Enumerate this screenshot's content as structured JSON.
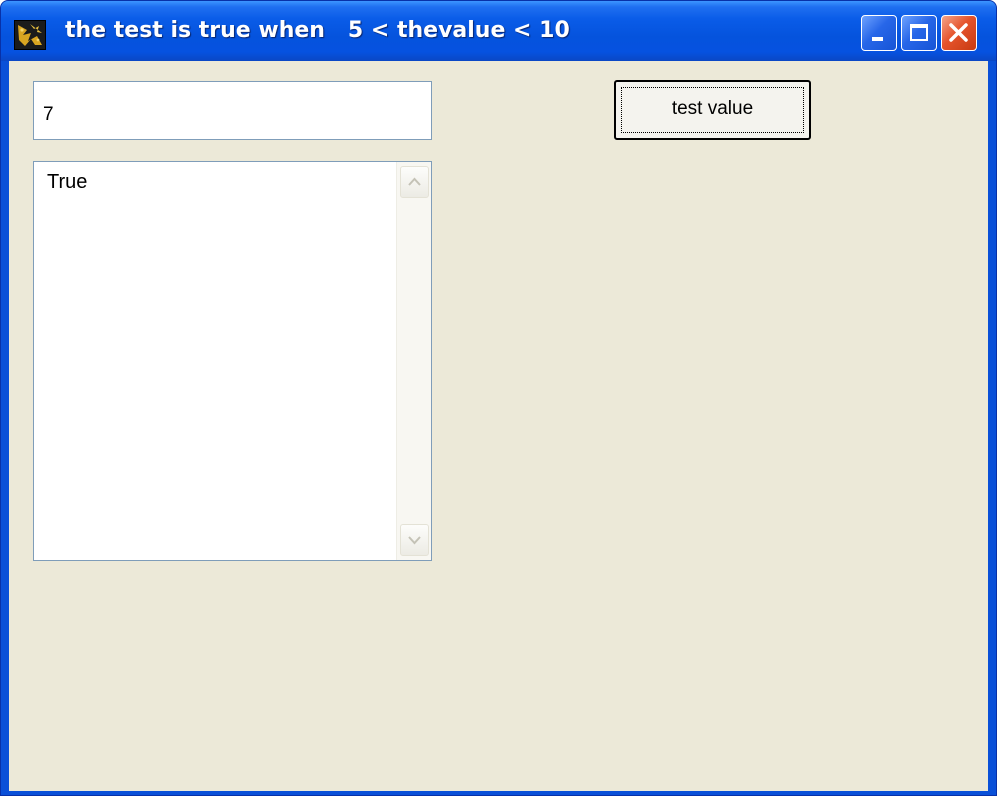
{
  "window": {
    "title": "the test is true when   5 < thevalue < 10",
    "icon": "app-icon",
    "controls": {
      "minimize": "minimize-icon",
      "maximize": "maximize-icon",
      "close": "close-icon"
    },
    "colors": {
      "titlebar": "#0553DD",
      "client": "#ECE9D8",
      "close_button": "#E5532B"
    }
  },
  "form": {
    "input_value": "7",
    "output_text": "True",
    "button_label": "test value"
  }
}
